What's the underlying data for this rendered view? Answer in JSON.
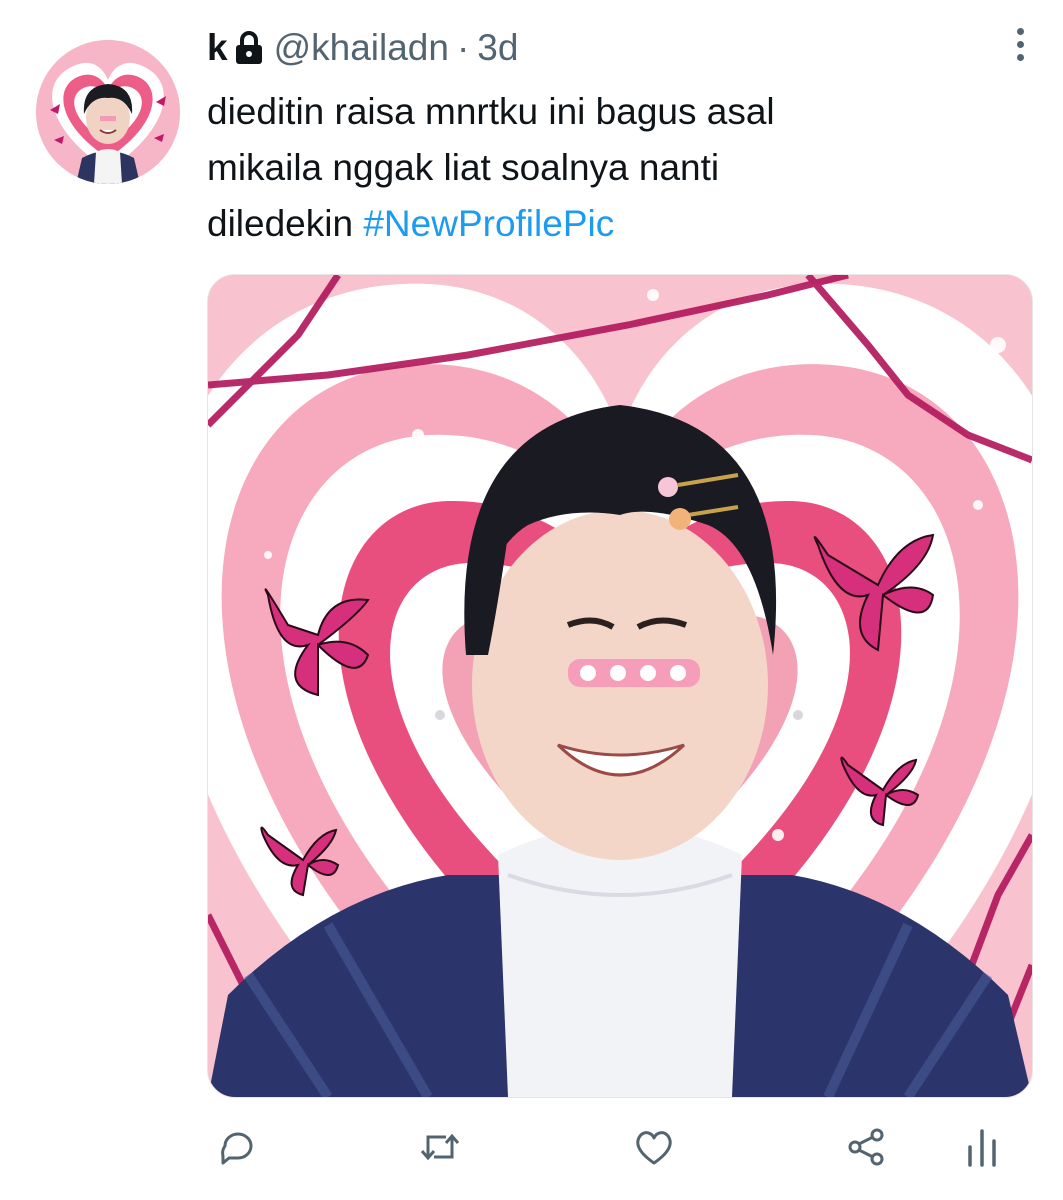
{
  "tweet": {
    "display_name": "k",
    "handle": "@khailadn",
    "separator": "·",
    "time": "3d",
    "text_line1": "dieditin raisa mnrtku ini bagus asal",
    "text_line2": "mikaila nggak liat soalnya nanti",
    "text_line3_prefix": "diledekin ",
    "hashtag": "#NewProfilePic"
  },
  "icons": {
    "lock": "lock-icon",
    "more": "more-icon",
    "reply": "reply-icon",
    "retweet": "retweet-icon",
    "like": "heart-icon",
    "share": "share-icon",
    "analytics": "analytics-icon"
  },
  "colors": {
    "text": "#0f1419",
    "secondary": "#536471",
    "link": "#1d9bf0",
    "media_pink": "#f7b8c6",
    "heart_pink": "#e94f7e"
  }
}
